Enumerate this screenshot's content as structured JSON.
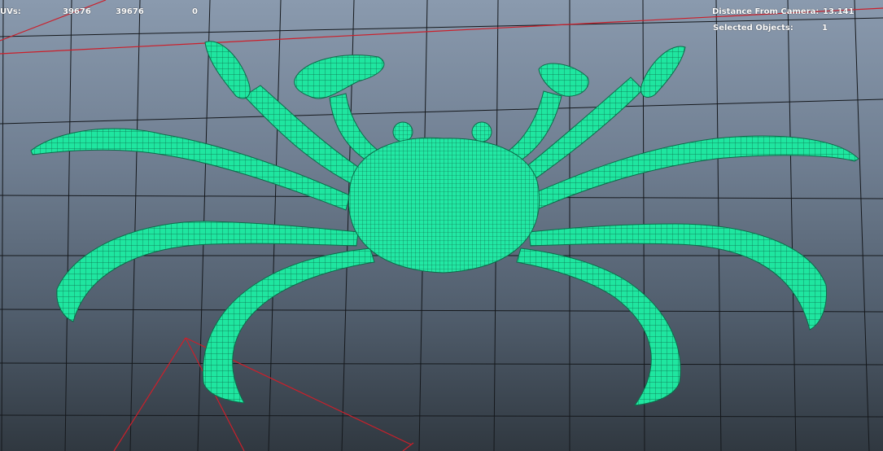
{
  "hud": {
    "uvs_label": "UVs:",
    "uvs_values": [
      "39676",
      "39676",
      "0"
    ],
    "distance_label": "Distance From Camera:",
    "distance_value": "13.141",
    "selected_label": "Selected Objects:",
    "selected_value": "1"
  },
  "colors": {
    "wireframe": "#1fe6a0",
    "wireframe_line": "#0d6b4a",
    "grid": "#15181c",
    "axis": "#cc1f2a",
    "background_top": "#8a9aae",
    "background_bottom": "#303840"
  },
  "viewport": {
    "mesh_name": "crab-wireframe-model",
    "display_mode": "wireframe-on-shaded"
  }
}
